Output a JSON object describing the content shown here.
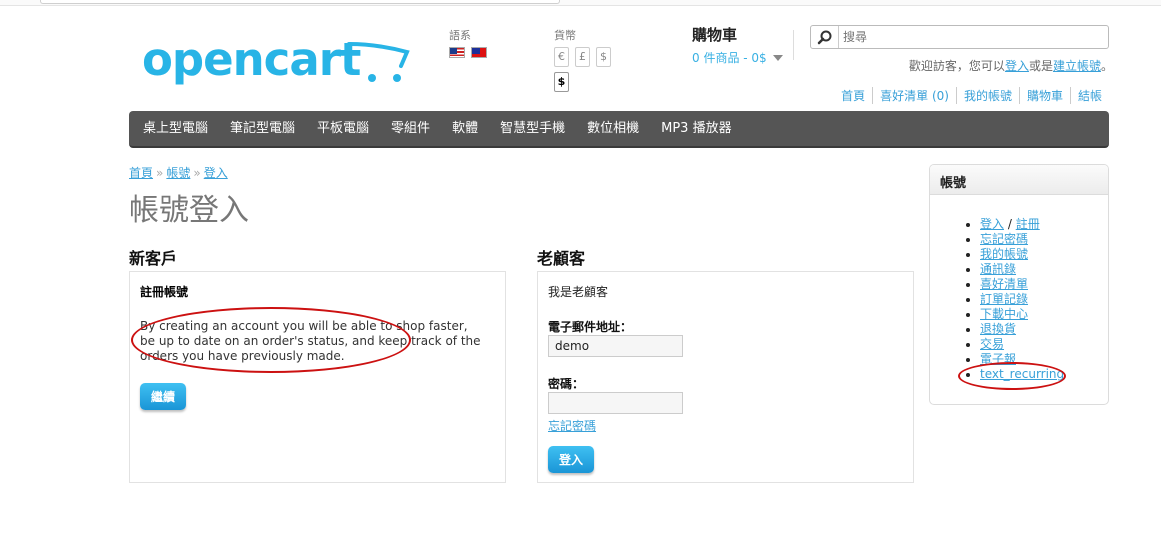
{
  "header": {
    "logo_text": "opencart",
    "language_label": "語系",
    "languages": [
      "us-flag-icon",
      "tw-flag-icon"
    ],
    "currency_label": "貨幣",
    "currencies": [
      "€",
      "£",
      "$"
    ],
    "currency_selected": "$",
    "cart_title": "購物車",
    "cart_summary": "0 件商品 - 0$",
    "search_placeholder": "搜尋",
    "welcome_prefix": "歡迎訪客，您可以",
    "welcome_login": "登入",
    "welcome_middle": "或是",
    "welcome_register": "建立帳號",
    "welcome_suffix": "。",
    "top_links": [
      "首頁",
      "喜好清單 (0)",
      "我的帳號",
      "購物車",
      "結帳"
    ]
  },
  "menu": [
    "桌上型電腦",
    "筆記型電腦",
    "平板電腦",
    "零組件",
    "軟體",
    "智慧型手機",
    "數位相機",
    "MP3 播放器"
  ],
  "breadcrumb": [
    "首頁",
    "帳號",
    "登入"
  ],
  "breadcrumb_sep": "»",
  "page_title": "帳號登入",
  "new_customer": {
    "heading": "新客戶",
    "box_title": "註冊帳號",
    "description": "By creating an account you will be able to shop faster, be up to date on an order's status, and keep track of the orders you have previously made.",
    "continue_button": "繼續"
  },
  "returning_customer": {
    "heading": "老顧客",
    "intro": "我是老顧客",
    "email_label": "電子郵件地址：",
    "email_value": "demo",
    "password_label": "密碼：",
    "password_value": "",
    "forgot_link": "忘記密碼",
    "login_button": "登入"
  },
  "sidebar": {
    "title": "帳號",
    "login": "登入",
    "slash": "/",
    "register": "註冊",
    "items": [
      "忘記密碼",
      "我的帳號",
      "通訊錄",
      "喜好清單",
      "訂單記錄",
      "下載中心",
      "退換貨",
      "交易",
      "電子報",
      "text_recurring"
    ]
  },
  "annotation_color": "#cc1111",
  "accent_color": "#28b4e6"
}
